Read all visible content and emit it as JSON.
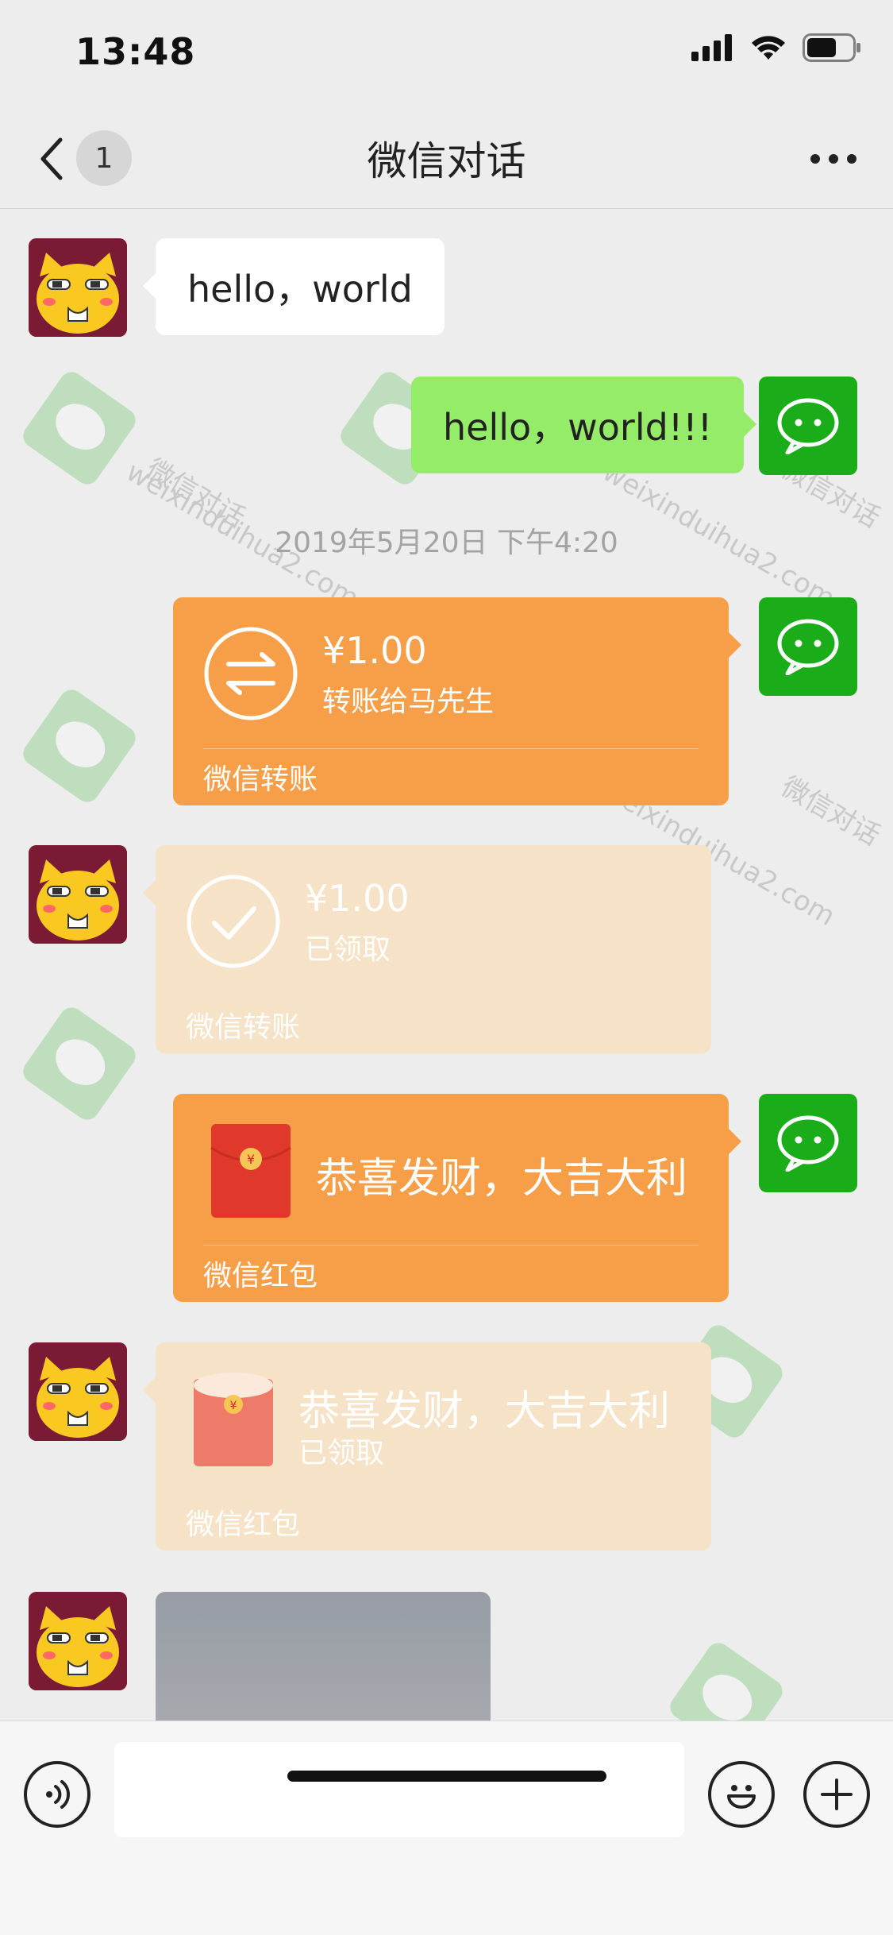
{
  "status_bar": {
    "time": "13:48"
  },
  "nav": {
    "back_badge": "1",
    "title": "微信对话"
  },
  "messages": {
    "m1_text": "hello，world",
    "m2_text": "hello，world!!!",
    "timestamp": "2019年5月20日 下午4:20",
    "transfer_sent": {
      "amount": "¥1.00",
      "note": "转账给马先生",
      "footer": "微信转账"
    },
    "transfer_received": {
      "amount": "¥1.00",
      "note": "已领取",
      "footer": "微信转账"
    },
    "redpacket_sent": {
      "greeting": "恭喜发财，大吉大利",
      "footer": "微信红包"
    },
    "redpacket_received": {
      "greeting": "恭喜发财，大吉大利",
      "status": "已领取",
      "footer": "微信红包"
    }
  },
  "watermark": {
    "cn": "微信对话",
    "url": "weixinduihua2.com"
  },
  "input": {
    "placeholder": ""
  },
  "colors": {
    "bubble_green": "#95ec69",
    "wechat_green": "#1aad19",
    "transfer_orange": "#f79f48",
    "received_pale": "#f6e2c6"
  }
}
